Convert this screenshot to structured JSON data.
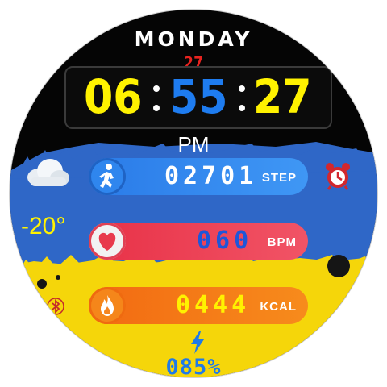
{
  "header": {
    "day": "MONDAY",
    "date": "27"
  },
  "clock": {
    "hours": "06",
    "minutes": "55",
    "seconds": "27",
    "period": "PM"
  },
  "weather": {
    "icon": "cloud-icon",
    "temperature": "-20°"
  },
  "metrics": [
    {
      "icon": "walk-icon",
      "value": "02701",
      "unit": "STEP"
    },
    {
      "icon": "heart-icon",
      "value": "060",
      "unit": "BPM"
    },
    {
      "icon": "flame-icon",
      "value": "0444",
      "unit": "KCAL"
    }
  ],
  "status": {
    "alarm_icon": "alarm-clock-icon",
    "bluetooth_icon": "bluetooth-icon",
    "charge_icon": "lightning-icon",
    "battery": "085%"
  },
  "colors": {
    "flag_blue": "#2f67c7",
    "flag_yellow": "#f5d60a",
    "time_accent": "#1e7cf0",
    "time_main": "#fff200"
  }
}
